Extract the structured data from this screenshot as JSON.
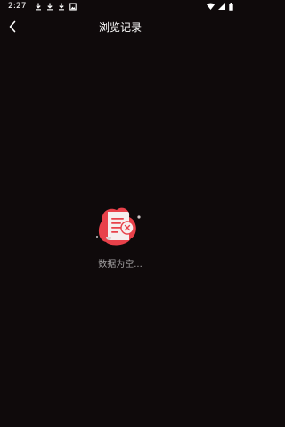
{
  "status_bar": {
    "time": "2:27",
    "notifications": [
      "download-icon",
      "download-icon",
      "download-icon",
      "photo-icon"
    ],
    "right_icons": [
      "wifi-icon",
      "signal-icon",
      "battery-icon"
    ]
  },
  "header": {
    "title": "浏览记录",
    "back_icon": "chevron-left-icon"
  },
  "empty_state": {
    "illustration": "empty-document-icon",
    "message": "数据为空..."
  },
  "colors": {
    "background": "#0f0a0b",
    "accent": "#e8414a",
    "muted_text": "#a5a3a4"
  }
}
